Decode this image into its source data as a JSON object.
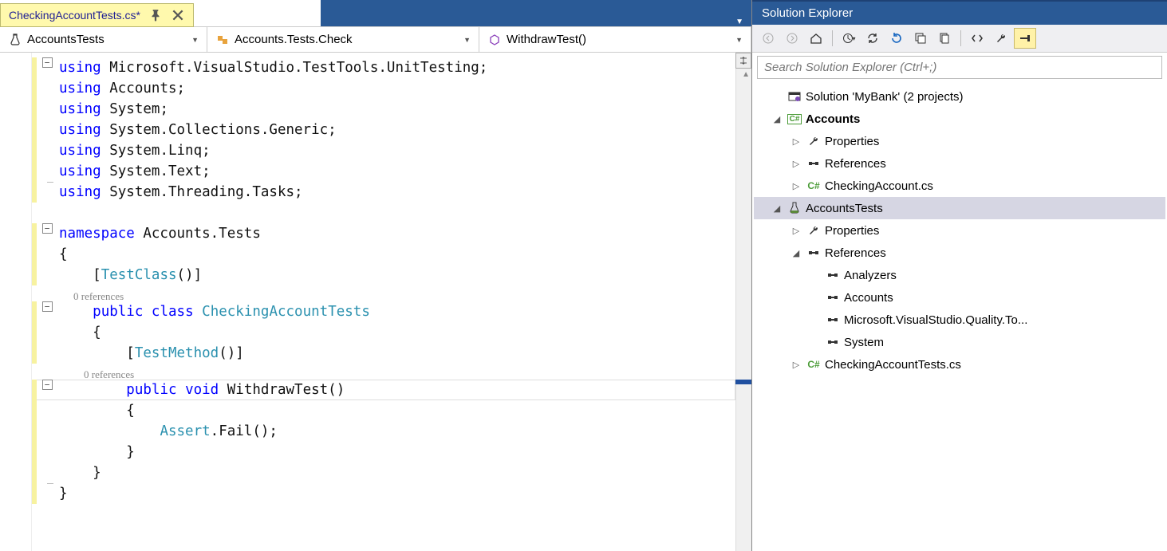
{
  "tab": {
    "label": "CheckingAccountTests.cs*"
  },
  "nav": {
    "scope": "AccountsTests",
    "class": "Accounts.Tests.Check",
    "method": "WithdrawTest()"
  },
  "code": {
    "lines": [
      {
        "change": true,
        "fold": "minus",
        "tokens": [
          [
            "kw",
            "using"
          ],
          [
            "txt",
            " Microsoft.VisualStudio.TestTools.UnitTesting;"
          ]
        ]
      },
      {
        "change": true,
        "fold": "line",
        "tokens": [
          [
            "kw",
            "using"
          ],
          [
            "txt",
            " Accounts;"
          ]
        ]
      },
      {
        "change": true,
        "fold": "line",
        "tokens": [
          [
            "kw",
            "using"
          ],
          [
            "txt",
            " System;"
          ]
        ]
      },
      {
        "change": true,
        "fold": "line",
        "tokens": [
          [
            "kw",
            "using"
          ],
          [
            "txt",
            " System.Collections.Generic;"
          ]
        ]
      },
      {
        "change": true,
        "fold": "line",
        "tokens": [
          [
            "kw",
            "using"
          ],
          [
            "txt",
            " System.Linq;"
          ]
        ]
      },
      {
        "change": true,
        "fold": "line",
        "tokens": [
          [
            "kw",
            "using"
          ],
          [
            "txt",
            " System.Text;"
          ]
        ]
      },
      {
        "change": true,
        "fold": "end",
        "tokens": [
          [
            "kw",
            "using"
          ],
          [
            "txt",
            " System.Threading.Tasks;"
          ]
        ]
      },
      {
        "change": false,
        "fold": "",
        "tokens": [
          [
            "txt",
            ""
          ]
        ]
      },
      {
        "change": true,
        "fold": "minus",
        "tokens": [
          [
            "kw",
            "namespace"
          ],
          [
            "txt",
            " Accounts.Tests"
          ]
        ]
      },
      {
        "change": true,
        "fold": "line",
        "tokens": [
          [
            "txt",
            "{"
          ]
        ]
      },
      {
        "change": true,
        "fold": "line",
        "tokens": [
          [
            "txt",
            "    ["
          ],
          [
            "typ",
            "TestClass"
          ],
          [
            "txt",
            "()]"
          ]
        ]
      },
      {
        "change": false,
        "fold": "line",
        "codelens": "    0 references"
      },
      {
        "change": true,
        "fold": "minus2",
        "tokens": [
          [
            "txt",
            "    "
          ],
          [
            "kw",
            "public"
          ],
          [
            "txt",
            " "
          ],
          [
            "kw",
            "class"
          ],
          [
            "txt",
            " "
          ],
          [
            "typ",
            "CheckingAccountTests"
          ]
        ]
      },
      {
        "change": true,
        "fold": "line2",
        "tokens": [
          [
            "txt",
            "    {"
          ]
        ]
      },
      {
        "change": true,
        "fold": "line2",
        "tokens": [
          [
            "txt",
            "        ["
          ],
          [
            "typ",
            "TestMethod"
          ],
          [
            "txt",
            "()]"
          ]
        ]
      },
      {
        "change": false,
        "fold": "line2",
        "codelens": "        0 references"
      },
      {
        "change": true,
        "fold": "minus3",
        "current": true,
        "tokens": [
          [
            "txt",
            "        "
          ],
          [
            "kw",
            "public"
          ],
          [
            "txt",
            " "
          ],
          [
            "kw",
            "void"
          ],
          [
            "txt",
            " WithdrawTest()"
          ]
        ]
      },
      {
        "change": true,
        "fold": "line3",
        "tokens": [
          [
            "txt",
            "        {"
          ]
        ]
      },
      {
        "change": true,
        "fold": "line3",
        "tokens": [
          [
            "txt",
            "            "
          ],
          [
            "typ",
            "Assert"
          ],
          [
            "txt",
            ".Fail();"
          ]
        ]
      },
      {
        "change": true,
        "fold": "line3",
        "tokens": [
          [
            "txt",
            "        }"
          ]
        ]
      },
      {
        "change": true,
        "fold": "line2",
        "tokens": [
          [
            "txt",
            "    }"
          ]
        ]
      },
      {
        "change": true,
        "fold": "end1",
        "tokens": [
          [
            "txt",
            "}"
          ]
        ]
      }
    ]
  },
  "solutionExplorer": {
    "title": "Solution Explorer",
    "searchPlaceholder": "Search Solution Explorer (Ctrl+;)",
    "tree": [
      {
        "depth": 0,
        "tw": "",
        "icon": "solution",
        "label": "Solution 'MyBank' (2 projects)"
      },
      {
        "depth": 0,
        "tw": "◢",
        "icon": "csproj",
        "label": "Accounts",
        "bold": true
      },
      {
        "depth": 1,
        "tw": "▷",
        "icon": "wrench",
        "label": "Properties"
      },
      {
        "depth": 1,
        "tw": "▷",
        "icon": "ref",
        "label": "References"
      },
      {
        "depth": 1,
        "tw": "▷",
        "icon": "cs",
        "label": "CheckingAccount.cs"
      },
      {
        "depth": 0,
        "tw": "◢",
        "icon": "flask",
        "label": "AccountsTests",
        "selected": true
      },
      {
        "depth": 1,
        "tw": "▷",
        "icon": "wrench",
        "label": "Properties"
      },
      {
        "depth": 1,
        "tw": "◢",
        "icon": "ref",
        "label": "References"
      },
      {
        "depth": 2,
        "tw": "",
        "icon": "ref",
        "label": "Analyzers"
      },
      {
        "depth": 2,
        "tw": "",
        "icon": "ref",
        "label": "Accounts"
      },
      {
        "depth": 2,
        "tw": "",
        "icon": "ref",
        "label": "Microsoft.VisualStudio.Quality.To..."
      },
      {
        "depth": 2,
        "tw": "",
        "icon": "ref",
        "label": "System"
      },
      {
        "depth": 1,
        "tw": "▷",
        "icon": "cs",
        "label": "CheckingAccountTests.cs"
      }
    ]
  }
}
